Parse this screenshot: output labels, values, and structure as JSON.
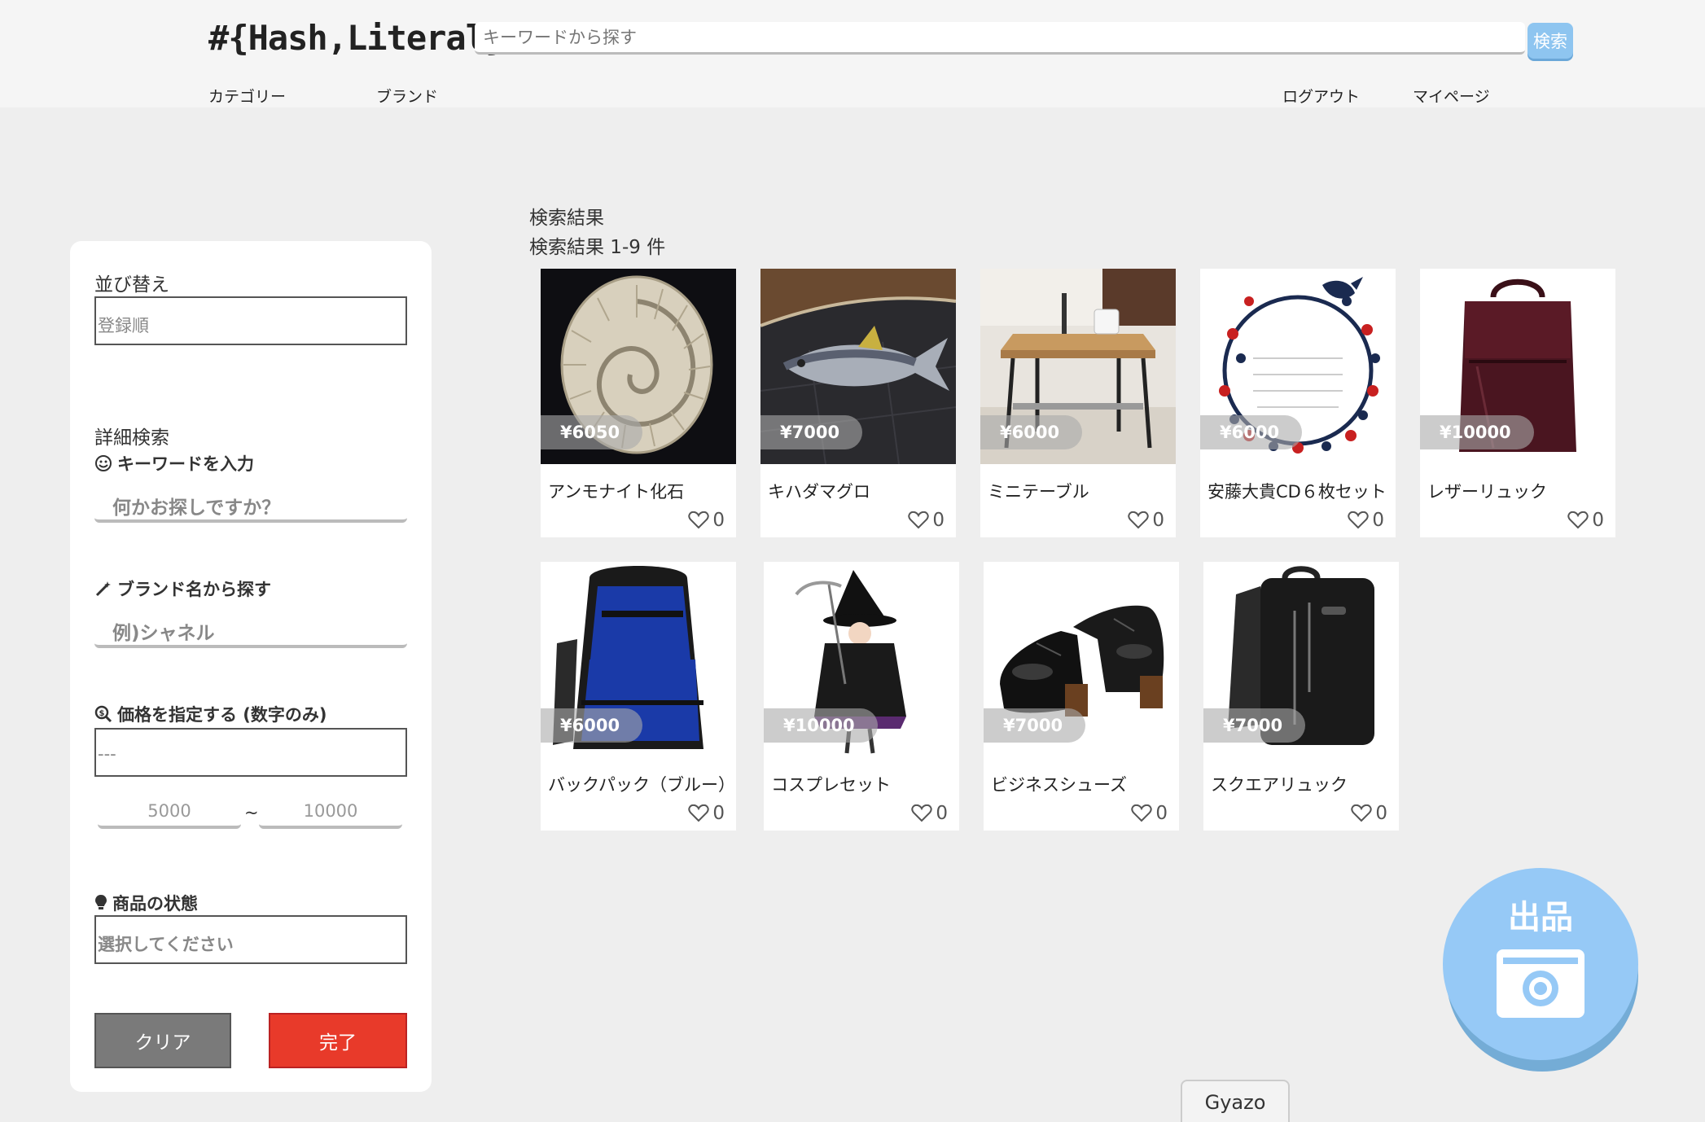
{
  "header": {
    "logo": "#{Hash,Literal}",
    "search_placeholder": "キーワードから探す",
    "search_button": "検索",
    "nav_left": [
      "カテゴリー",
      "ブランド"
    ],
    "nav_right": [
      "ログアウト",
      "マイページ"
    ]
  },
  "sidebar": {
    "sort_label": "並び替え",
    "sort_value": "登録順",
    "detail_label": "詳細検索",
    "keyword_label": "キーワードを入力",
    "keyword_placeholder": "何かお探しですか？",
    "brand_label": "ブランド名から探す",
    "brand_placeholder": "例)シャネル",
    "price_label": "価格を指定する (数字のみ)",
    "price_select": "---",
    "price_min": "5000",
    "price_sep": "~",
    "price_max": "10000",
    "condition_label": "商品の状態",
    "condition_placeholder": "選択してください",
    "clear_button": "クリア",
    "done_button": "完了"
  },
  "results": {
    "title": "検索結果",
    "count": "検索結果 1-9 件",
    "items": [
      {
        "name": "アンモナイト化石",
        "price": "¥6050",
        "likes": "0",
        "image": "ammonite-fossil"
      },
      {
        "name": "キハダマグロ",
        "price": "¥7000",
        "likes": "0",
        "image": "tuna"
      },
      {
        "name": "ミニテーブル",
        "price": "¥6000",
        "likes": "0",
        "image": "mini-table"
      },
      {
        "name": "安藤大貴CD６枚セット",
        "price": "¥6000",
        "likes": "0",
        "image": "floral-wreath"
      },
      {
        "name": "レザーリュック",
        "price": "¥10000",
        "likes": "0",
        "image": "leather-backpack"
      },
      {
        "name": "バックパック（ブルー）",
        "price": "¥6000",
        "likes": "0",
        "image": "blue-backpack"
      },
      {
        "name": "コスプレセット",
        "price": "¥10000",
        "likes": "0",
        "image": "witch-costume"
      },
      {
        "name": "ビジネスシューズ",
        "price": "¥7000",
        "likes": "0",
        "image": "business-shoes"
      },
      {
        "name": "スクエアリュック",
        "price": "¥7000",
        "likes": "0",
        "image": "square-backpack"
      }
    ]
  },
  "sell_button": "出品",
  "gyazo": "Gyazo",
  "colors": {
    "accent": "#8ec5f0",
    "done": "#e83a2a",
    "clear": "#7a7a7a",
    "sell": "#96c9f6"
  }
}
